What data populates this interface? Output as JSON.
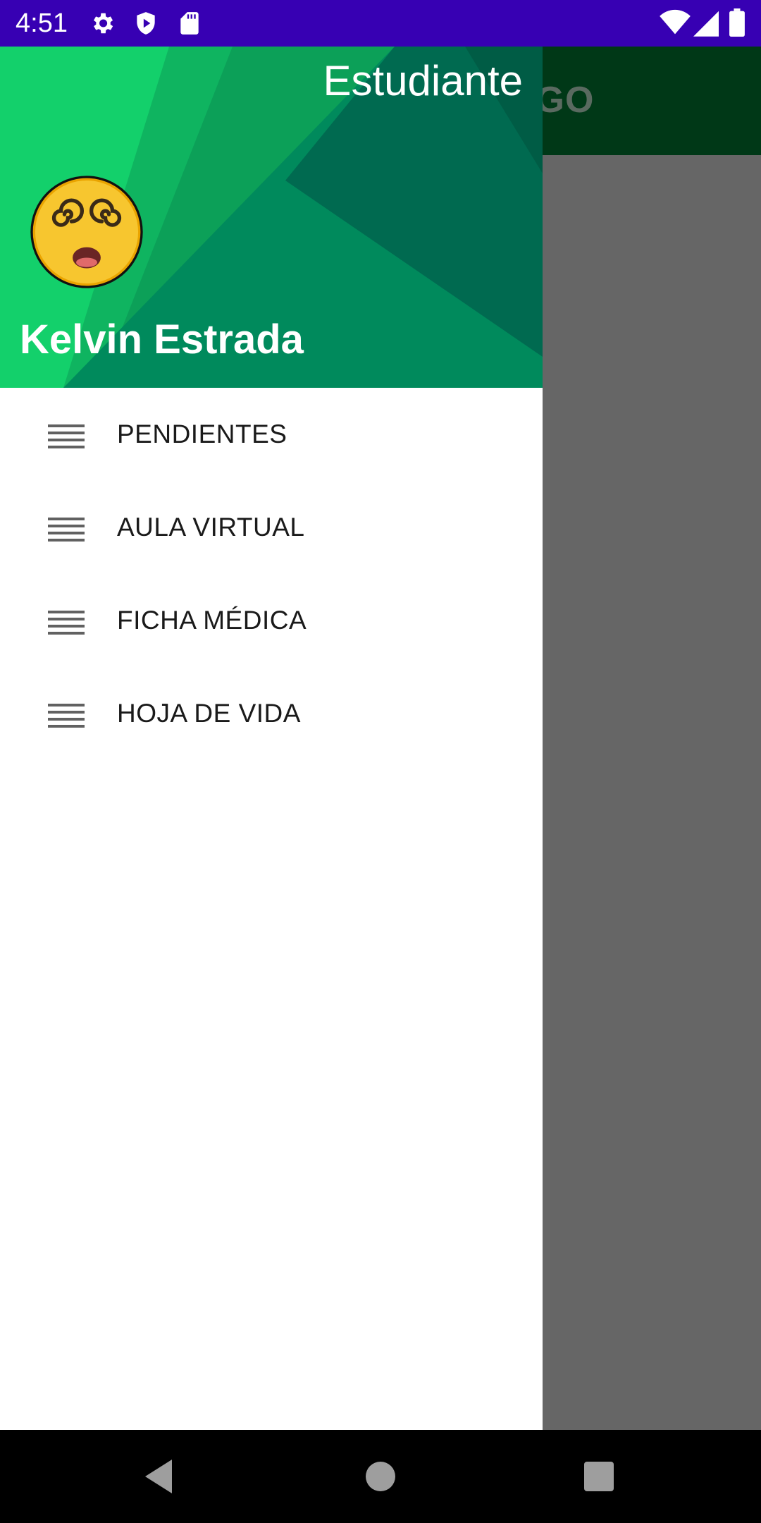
{
  "status_bar": {
    "time": "4:51",
    "icons_left": [
      "settings-icon",
      "shield-icon",
      "sd-card-icon"
    ],
    "icons_right": [
      "wifi-icon",
      "cell-signal-icon",
      "battery-icon"
    ],
    "background": "#3700b3"
  },
  "app": {
    "toolbar_title_partial": "E ALGO",
    "toolbar_color": "#003817"
  },
  "drawer": {
    "header": {
      "subtitle": "Estudiante",
      "user_name": "Kelvin Estrada",
      "avatar": "dizzy-face-emoji",
      "colors": [
        "#13d06b",
        "#0fa857",
        "#008a5c",
        "#006a50"
      ]
    },
    "menu": [
      {
        "label": "PENDIENTES",
        "icon": "menu-icon"
      },
      {
        "label": "AULA VIRTUAL",
        "icon": "menu-icon"
      },
      {
        "label": "FICHA MÉDICA",
        "icon": "menu-icon"
      },
      {
        "label": "HOJA DE VIDA",
        "icon": "menu-icon"
      }
    ]
  },
  "nav_bar": {
    "buttons": [
      "back-icon",
      "home-icon",
      "recents-icon"
    ]
  }
}
